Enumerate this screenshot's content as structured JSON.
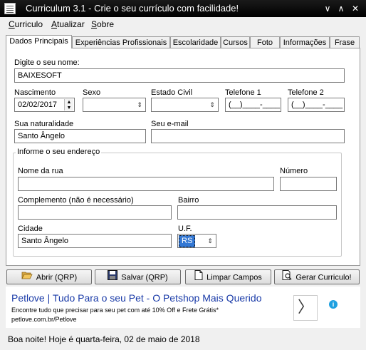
{
  "window": {
    "title": "Curriculum 3.1 - Crie o seu currículo com facilidade!"
  },
  "menu": [
    {
      "pre": "",
      "accel": "C",
      "rest": "urriculo"
    },
    {
      "pre": "",
      "accel": "A",
      "rest": "tualizar"
    },
    {
      "pre": "",
      "accel": "S",
      "rest": "obre"
    }
  ],
  "tabs": [
    "Dados Principais",
    "Experiências Profissionais",
    "Escolaridade",
    "Cursos",
    "Foto",
    "Informações",
    "Frase"
  ],
  "form": {
    "name_label": "Digite o seu nome:",
    "name_value": "BAIXESOFT",
    "birth_label": "Nascimento",
    "birth_value": "02/02/2017",
    "sex_label": "Sexo",
    "sex_value": "",
    "civil_label": "Estado Civil",
    "civil_value": "",
    "phone1_label": "Telefone 1",
    "phone1_value": "(__)____-____",
    "phone2_label": "Telefone 2",
    "phone2_value": "(__)____-____",
    "birthplace_label": "Sua naturalidade",
    "birthplace_value": "Santo Ângelo",
    "email_label": "Seu e-mail",
    "email_value": "",
    "address_group": "Informe o seu endereço",
    "street_label": "Nome da rua",
    "street_value": "",
    "number_label": "Número",
    "number_value": "",
    "complement_label": "Complemento (não é necessário)",
    "complement_value": "",
    "district_label": "Bairro",
    "district_value": "",
    "city_label": "Cidade",
    "city_value": "Santo Ângelo",
    "uf_label": "U.F.",
    "uf_value": "RS"
  },
  "buttons": {
    "open": "Abrir (QRP)",
    "save": "Salvar (QRP)",
    "clear": "Limpar Campos",
    "generate": "Gerar Curriculo!"
  },
  "ad": {
    "title": "Petlove | Tudo Para o seu Pet - O Petshop Mais Querido",
    "description": "Encontre tudo que precisar para seu pet com até 10% Off e Frete Grátis*",
    "url": "petlove.com.br/Petlove",
    "arrow": "〉",
    "info": "i"
  },
  "status": {
    "text": "Boa noite! Hoje é quarta-feira, 02  de maio de  2018"
  },
  "colors": {
    "titlebar": "#000000",
    "ad_title": "#1a3ba8",
    "uf_selected": "#3478d4"
  }
}
